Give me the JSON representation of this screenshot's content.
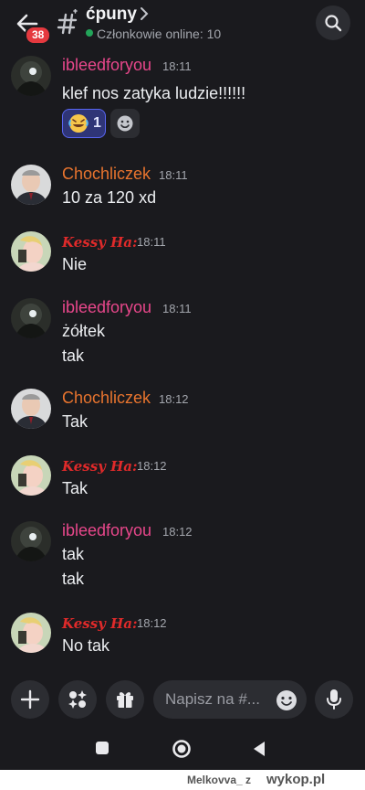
{
  "header": {
    "badge_count": "38",
    "channel_name": "ćpuny",
    "online_text": "Członkowie online: 10"
  },
  "messages": [
    {
      "user": "ibleedforyou",
      "time": "18:11",
      "lines": [
        "klef nos zatyka ludzie!!!!!!"
      ],
      "reaction": {
        "emoji": "rolling-on-floor-laughing",
        "count": "1"
      }
    },
    {
      "user": "Chochliczek",
      "time": "18:11",
      "lines": [
        "10 za 120 xd"
      ]
    },
    {
      "user": "Kessy Ha:",
      "time": "18:11",
      "lines": [
        "Nie"
      ]
    },
    {
      "user": "ibleedforyou",
      "time": "18:11",
      "lines": [
        "żółtek",
        "tak"
      ]
    },
    {
      "user": "Chochliczek",
      "time": "18:12",
      "lines": [
        "Tak"
      ]
    },
    {
      "user": "Kessy Ha:",
      "time": "18:12",
      "lines": [
        "Tak"
      ]
    },
    {
      "user": "ibleedforyou",
      "time": "18:12",
      "lines": [
        "tak",
        "tak"
      ]
    },
    {
      "user": "Kessy Ha:",
      "time": "18:12",
      "lines": [
        "No tak"
      ]
    }
  ],
  "composer": {
    "placeholder": "Napisz na #..."
  },
  "footer": {
    "user": "Melkovva_  z",
    "site": "wykop.pl"
  },
  "colors": {
    "background": "#1a1a1e",
    "accent": "#5865f2",
    "online": "#23a55a",
    "badge": "#e5393f"
  }
}
